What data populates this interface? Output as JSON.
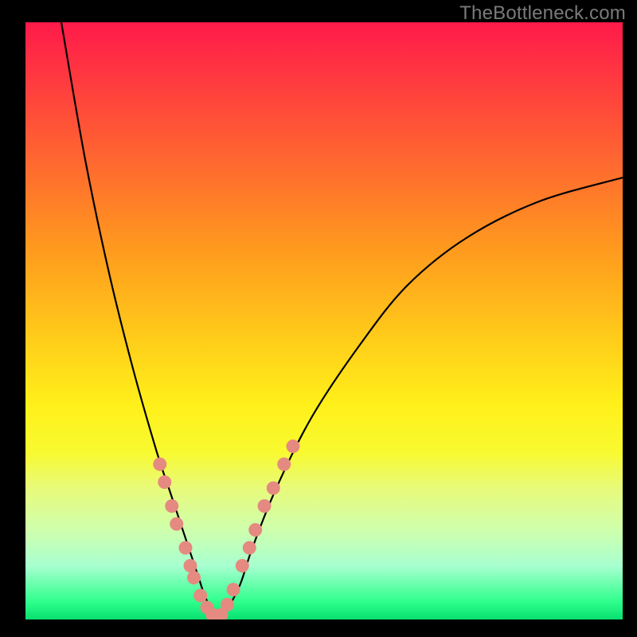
{
  "watermark": "TheBottleneck.com",
  "colors": {
    "background": "#000000",
    "curve": "#000000",
    "bead": "#e58a80",
    "gradient_stops": [
      "#ff1a4a",
      "#ff3b3f",
      "#ff6a2f",
      "#ff9a1e",
      "#ffc91a",
      "#fff01a",
      "#f8fa30",
      "#e8fa7a",
      "#cfffad",
      "#a8ffd0",
      "#2fff8c",
      "#08e070"
    ]
  },
  "chart_data": {
    "type": "line",
    "title": "",
    "xlabel": "",
    "ylabel": "",
    "xlim": [
      0,
      100
    ],
    "ylim": [
      0,
      100
    ],
    "grid": false,
    "legend": false,
    "series": [
      {
        "name": "curve",
        "x": [
          6,
          10,
          14,
          18,
          22,
          24,
          26,
          28,
          29,
          30,
          31,
          32,
          33,
          34,
          36,
          38,
          42,
          48,
          56,
          64,
          74,
          86,
          100
        ],
        "y": [
          100,
          77,
          58,
          42,
          28,
          22,
          16,
          10,
          7,
          4,
          2,
          0.5,
          0.5,
          2,
          6,
          12,
          22,
          34,
          46,
          56,
          64,
          70,
          74
        ]
      }
    ],
    "beads_left": {
      "name": "left-cluster",
      "x": [
        22.5,
        23.3,
        24.5,
        25.3,
        26.8,
        27.6,
        28.2,
        29.3,
        30.4,
        31.3
      ],
      "y": [
        26,
        23,
        19,
        16,
        12,
        9,
        7,
        4,
        2,
        0.8
      ]
    },
    "beads_right": {
      "name": "right-cluster",
      "x": [
        32.8,
        33.8,
        34.8,
        36.3,
        37.5,
        38.5,
        40.0,
        41.5,
        43.3,
        44.8
      ],
      "y": [
        0.8,
        2.5,
        5,
        9,
        12,
        15,
        19,
        22,
        26,
        29
      ]
    }
  }
}
